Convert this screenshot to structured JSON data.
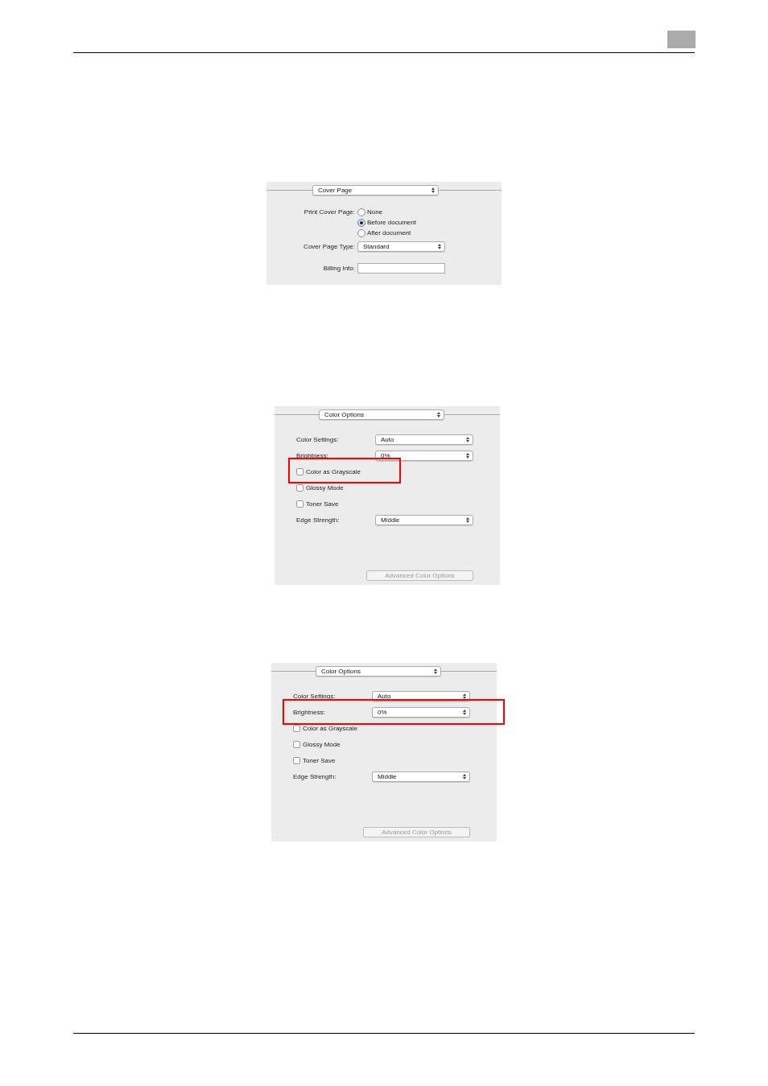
{
  "panels": [
    {
      "kind": "cover",
      "menu": "Cover Page",
      "rows": [
        {
          "kind": "radio",
          "label": "Print Cover Page:",
          "options": [
            {
              "label": "None",
              "selected": false
            },
            {
              "label": "Before document",
              "selected": true
            },
            {
              "label": "After document",
              "selected": false
            }
          ]
        },
        {
          "kind": "popup",
          "label": "Cover Page Type:",
          "value": "Standard"
        },
        {
          "kind": "field",
          "label": "Billing Info:"
        }
      ]
    },
    {
      "kind": "color",
      "menu": "Color Options",
      "rows": [
        {
          "kind": "popup",
          "label": "Color Settings:",
          "value": "Auto",
          "highlighted": false
        },
        {
          "kind": "popup",
          "label": "Brightness:",
          "value": "0%",
          "highlighted": false
        },
        {
          "kind": "checkbox",
          "label": "Color as Grayscale",
          "checked": false,
          "highlighted": true
        },
        {
          "kind": "checkbox",
          "label": "Glossy Mode",
          "checked": false,
          "highlighted": false
        },
        {
          "kind": "checkbox",
          "label": "Toner Save",
          "checked": false,
          "highlighted": false
        },
        {
          "kind": "popup",
          "label": "Edge Strength:",
          "value": "Middle",
          "highlighted": false
        }
      ],
      "button": {
        "label": "Advanced Color Options",
        "disabled": true
      }
    },
    {
      "kind": "color",
      "menu": "Color Options",
      "rows": [
        {
          "kind": "popup",
          "label": "Color Settings:",
          "value": "Auto",
          "highlighted": false
        },
        {
          "kind": "popup",
          "label": "Brightness:",
          "value": "0%",
          "highlighted": true
        },
        {
          "kind": "checkbox",
          "label": "Color as Grayscale",
          "checked": false,
          "highlighted": false
        },
        {
          "kind": "checkbox",
          "label": "Glossy Mode",
          "checked": false,
          "highlighted": false
        },
        {
          "kind": "checkbox",
          "label": "Toner Save",
          "checked": false,
          "highlighted": false
        },
        {
          "kind": "popup",
          "label": "Edge Strength:",
          "value": "Middle",
          "highlighted": false
        }
      ],
      "button": {
        "label": "Advanced Color Options",
        "disabled": true
      }
    }
  ]
}
